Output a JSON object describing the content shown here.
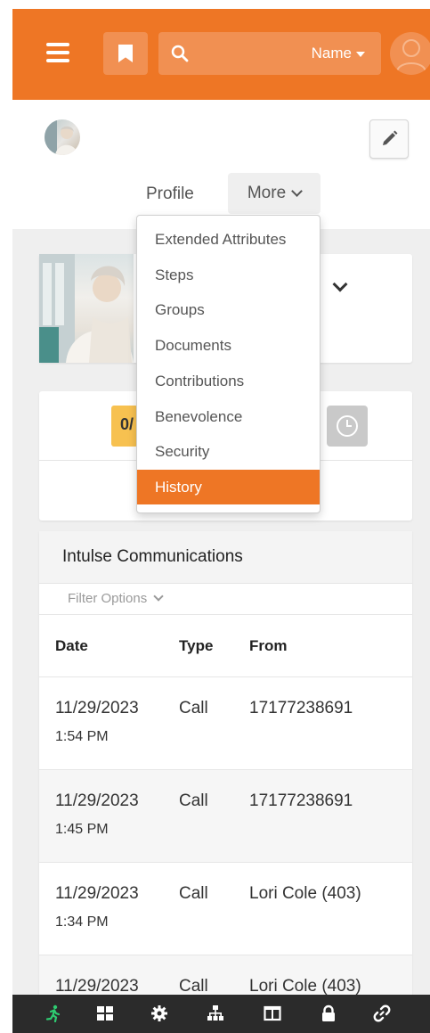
{
  "header": {
    "search_placeholder": "",
    "filter_label": "Name",
    "icons": [
      "menu-icon",
      "bookmark-icon",
      "search-icon",
      "user-avatar-icon"
    ]
  },
  "profile_nav": {
    "profile_tab": "Profile",
    "more_tab": "More"
  },
  "more_menu": {
    "items": [
      {
        "label": "Extended Attributes"
      },
      {
        "label": "Steps"
      },
      {
        "label": "Groups"
      },
      {
        "label": "Documents"
      },
      {
        "label": "Contributions"
      },
      {
        "label": "Benevolence"
      },
      {
        "label": "Security"
      },
      {
        "label": "History",
        "active": true
      }
    ]
  },
  "summary": {
    "badge_text": "0/"
  },
  "communications": {
    "title": "Intulse Communications",
    "filter_label": "Filter Options",
    "columns": [
      "Date",
      "Type",
      "From"
    ],
    "rows": [
      {
        "date": "11/29/2023",
        "time": "1:54 PM",
        "type": "Call",
        "from": "17177238691"
      },
      {
        "date": "11/29/2023",
        "time": "1:45 PM",
        "type": "Call",
        "from": "17177238691"
      },
      {
        "date": "11/29/2023",
        "time": "1:34 PM",
        "type": "Call",
        "from": "Lori Cole (403)"
      },
      {
        "date": "11/29/2023",
        "time": "",
        "type": "Call",
        "from": "Lori Cole (403)"
      }
    ]
  },
  "bottom_bar": {
    "icons": [
      "person-running-icon",
      "grid-icon",
      "gear-icon",
      "sitemap-icon",
      "columns-icon",
      "lock-icon",
      "link-icon"
    ]
  },
  "colors": {
    "accent": "#ee7625",
    "accent_light": "#f19052",
    "badge_yellow": "#f7c150",
    "active_green": "#2ecc71"
  }
}
